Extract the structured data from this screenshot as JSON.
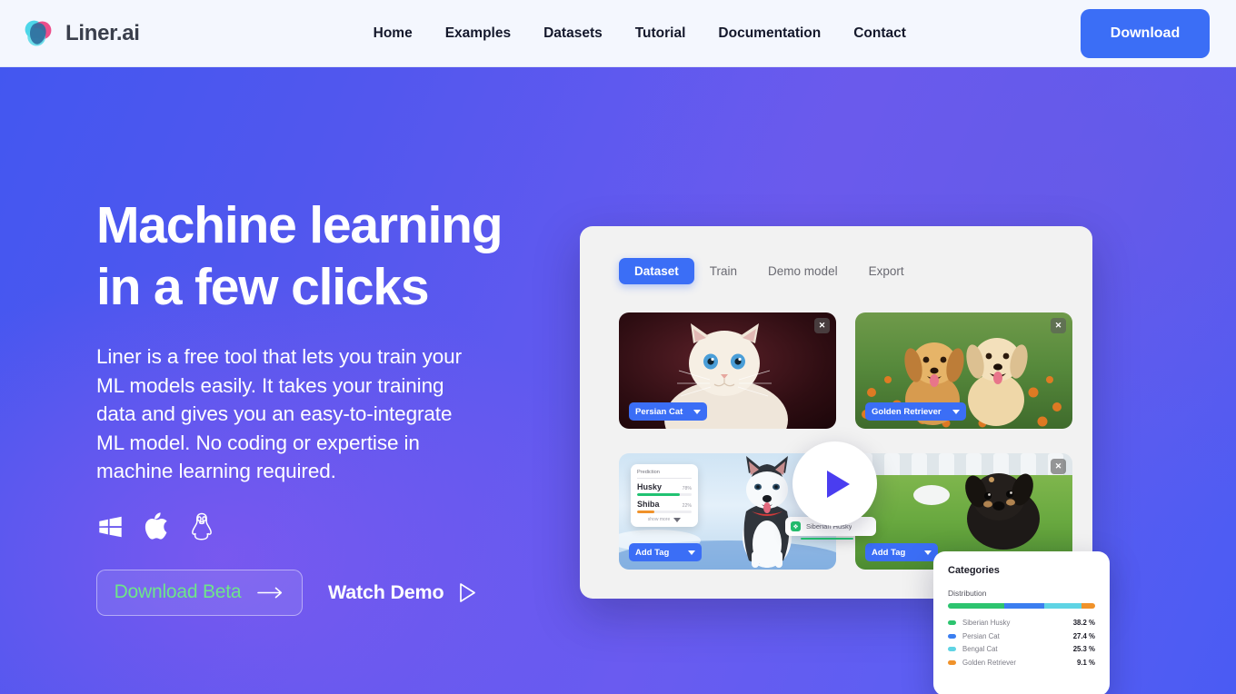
{
  "navbar": {
    "logo_icon": "liner-blob-logo-icon",
    "brand": "Liner.ai",
    "links": [
      {
        "label": "Home"
      },
      {
        "label": "Examples"
      },
      {
        "label": "Datasets"
      },
      {
        "label": "Tutorial"
      },
      {
        "label": "Documentation"
      },
      {
        "label": "Contact"
      }
    ],
    "cta": {
      "label": "Download",
      "color": "#3b6ef6"
    }
  },
  "hero": {
    "title_line1": "Machine learning",
    "title_line2": "in a few clicks",
    "subtitle": "Liner is a free tool that lets you train your ML models easily. It takes your training data and gives you an easy-to-integrate ML model. No coding or expertise in machine learning required.",
    "platforms": [
      {
        "icon": "windows-icon",
        "name": "Windows"
      },
      {
        "icon": "apple-icon",
        "name": "macOS"
      },
      {
        "icon": "linux-tux-icon",
        "name": "Linux"
      }
    ],
    "primary_cta": {
      "label": "Download Beta",
      "icon": "arrow-right-icon",
      "color": "#6ee58a"
    },
    "secondary_cta": {
      "label": "Watch Demo",
      "icon": "play-triangle-icon"
    },
    "background_colors": {
      "from": "#4357f0",
      "mid": "#6a5bf0",
      "to": "#4a5bf3"
    }
  },
  "app_mock": {
    "tabs": [
      {
        "label": "Dataset",
        "active": true
      },
      {
        "label": "Train",
        "active": false
      },
      {
        "label": "Demo model",
        "active": false
      },
      {
        "label": "Export",
        "active": false
      }
    ],
    "cards": [
      {
        "subject": "persian-cat-kitten-photo",
        "tag": "Persian Cat",
        "close_icon": "close-x-icon",
        "caret_icon": "caret-down-icon"
      },
      {
        "subject": "golden-retriever-puppies-photo",
        "tag": "Golden Retriever",
        "close_icon": "close-x-icon",
        "caret_icon": "caret-down-icon"
      },
      {
        "subject": "siberian-husky-snow-photo",
        "tag": "Add Tag",
        "close_icon": "close-x-icon",
        "caret_icon": "caret-down-icon"
      },
      {
        "subject": "black-tan-puppy-grass-photo",
        "tag": "Add Tag",
        "close_icon": "close-x-icon",
        "caret_icon": "caret-down-icon"
      }
    ],
    "prediction": {
      "title": "Prediction",
      "rows": [
        {
          "label": "Husky",
          "value": "78%",
          "pct": 78,
          "color": "#21c272"
        },
        {
          "label": "Shiba",
          "value": "22%",
          "pct": 32,
          "color": "#f0922a"
        }
      ],
      "more_label": "show more",
      "more_icon": "caret-down-icon"
    },
    "floating_dropdown": {
      "icon": "tag-green-icon",
      "label": "Siberian Husky"
    },
    "play_button": {
      "icon": "play-triangle-icon",
      "color": "#4a3df0"
    }
  },
  "categories_panel": {
    "title": "Categories",
    "distribution_label": "Distribution",
    "chart_data": {
      "type": "bar",
      "title": "Distribution",
      "categories": [
        "Siberian Husky",
        "Persian Cat",
        "Bengal Cat",
        "Golden Retriever"
      ],
      "values": [
        38.2,
        27.4,
        25.3,
        9.1
      ],
      "value_labels": [
        "38.2 %",
        "27.4 %",
        "25.3 %",
        "9.1 %"
      ],
      "colors": [
        "#2dc46f",
        "#3b7ef0",
        "#5fd4e4",
        "#f0922a"
      ],
      "xlabel": "",
      "ylabel": "",
      "ylim": [
        0,
        100
      ],
      "legend": "left",
      "grid": false
    }
  }
}
